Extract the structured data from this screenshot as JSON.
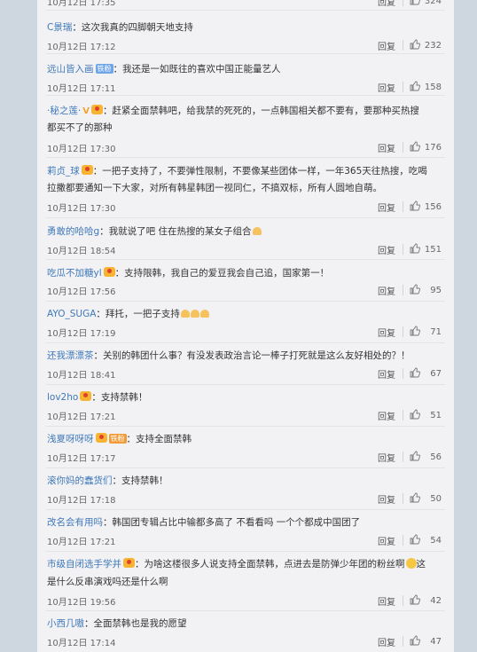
{
  "comments": [
    {
      "user": "",
      "text": "",
      "time": "10月12日 17:35",
      "reply": "回复",
      "likes": "324"
    },
    {
      "user": "C景瑞",
      "text": "：这次我真的四脚朝天地支持",
      "time": "10月12日 17:12",
      "reply": "回复",
      "likes": "232"
    },
    {
      "user": "远山皆入画",
      "tag": "铁粉",
      "text": "：我还是一如既往的喜欢中国正能量艺人",
      "time": "10月12日 17:11",
      "reply": "回复",
      "likes": "158"
    },
    {
      "user": "·秘之莲·",
      "text": "：赶紧全面禁韩吧，给我禁的死死的，一点韩国相关都不要有，要那种买热搜",
      "text2": "都买不了的那种",
      "time": "10月12日 17:30",
      "reply": "回复",
      "likes": "176"
    },
    {
      "user": "莉贞_球",
      "text": "：一把子支持了，不要弹性限制，不要像某些团体一样，一年365天往热搜，吃喝",
      "text2": "拉撒都要通知一下大家，对所有韩星韩团一视同仁，不搞双标，所有人圆地自萌。",
      "time": "10月12日 17:30",
      "reply": "回复",
      "likes": "156"
    },
    {
      "user": "勇敢的哈哈g",
      "text": "：我就说了吧 住在热搜的某女子组合",
      "time": "10月12日 18:54",
      "reply": "回复",
      "likes": "151"
    },
    {
      "user": "吃瓜不加糖yl",
      "text": "：支持限韩，我自己的爱豆我会自己追，国家第一！",
      "time": "10月12日 17:56",
      "reply": "回复",
      "likes": "95"
    },
    {
      "user": "AYO_SUGA",
      "text": "：拜托，一把子支持",
      "time": "10月12日 17:19",
      "reply": "回复",
      "likes": "71"
    },
    {
      "user": "还我漂漂茶",
      "text": "：关别的韩团什么事？有没发表政治言论一棒子打死就是这么友好相处的？！",
      "time": "10月12日 18:41",
      "reply": "回复",
      "likes": "67"
    },
    {
      "user": "lov2ho",
      "text": "：支持禁韩！",
      "time": "10月12日 17:21",
      "reply": "回复",
      "likes": "51"
    },
    {
      "user": "浅夏呀呀呀",
      "tag": "铁粉",
      "text": "：支持全面禁韩",
      "time": "10月12日 17:17",
      "reply": "回复",
      "likes": "56"
    },
    {
      "user": "滚你妈的蠢货们",
      "text": "：支持禁韩！",
      "time": "10月12日 17:18",
      "reply": "回复",
      "likes": "50"
    },
    {
      "user": "改名会有用吗",
      "text": "：韩国团专辑占比中输都多高了 不看看吗 一个个都成中国团了",
      "time": "10月12日 17:21",
      "reply": "回复",
      "likes": "54"
    },
    {
      "user": "市级自闭选手学并",
      "text": "：为啥这楼很多人说支持全面禁韩，点进去是防弹少年团的粉丝啊",
      "text_end": "这",
      "text2": "是什么反串演戏吗还是什么啊",
      "time": "10月12日 19:56",
      "reply": "回复",
      "likes": "42"
    },
    {
      "user": "小西几嗷",
      "text": "：全面禁韩也是我的愿望",
      "time": "10月12日 17:14",
      "reply": "回复",
      "likes": "47"
    }
  ]
}
